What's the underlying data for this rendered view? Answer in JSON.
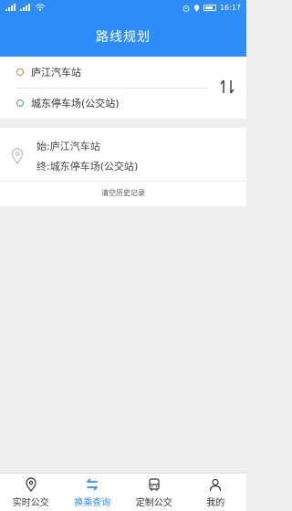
{
  "status": {
    "time": "16:17"
  },
  "header": {
    "title": "路线规划"
  },
  "route": {
    "origin": "庐江汽车站",
    "destination": "城东停车场(公交站)"
  },
  "history": {
    "start": "始:庐江汽车站",
    "end": "终:城东停车场(公交站)",
    "clear_label": "清空历史记录"
  },
  "tabs": [
    {
      "label": "实时公交",
      "icon": "location-pin-icon"
    },
    {
      "label": "换乘查询",
      "icon": "transfer-arrows-icon",
      "active": true
    },
    {
      "label": "定制公交",
      "icon": "bus-icon"
    },
    {
      "label": "我的",
      "icon": "user-icon"
    }
  ],
  "colors": {
    "accent": "#2f8dfa",
    "origin_dot": "#b08a4a",
    "destination_dot": "#5c8fbd"
  }
}
